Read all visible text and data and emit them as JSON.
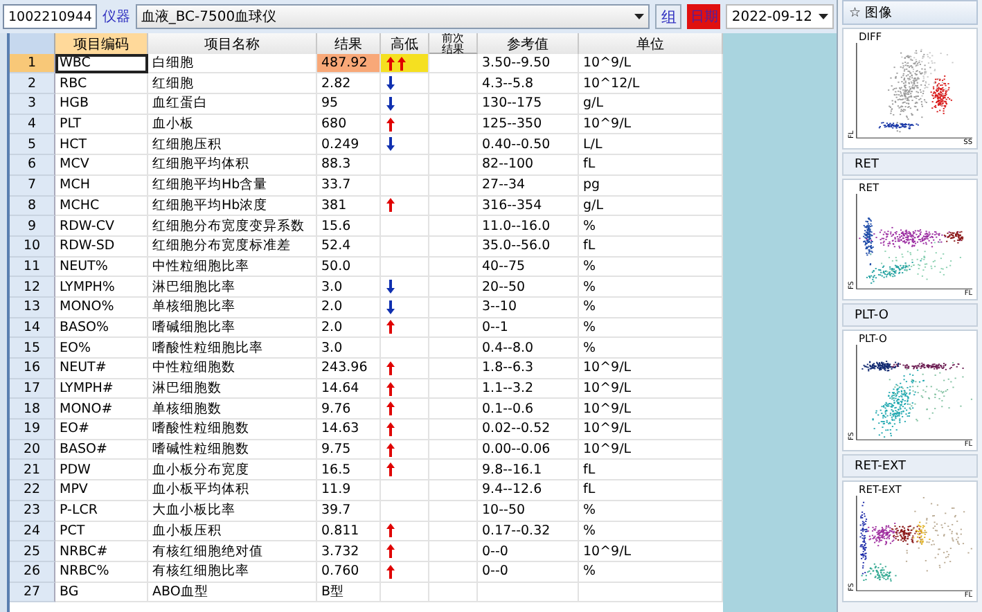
{
  "toolbar": {
    "sample_id": "1002210944",
    "instrument_label": "仪器",
    "instrument": "血液_BC-7500血球仪",
    "group_button": "组",
    "date_label": "日期",
    "date": "2022-09-12"
  },
  "table": {
    "columns": [
      "项目编码",
      "项目名称",
      "结果",
      "高低",
      "前次结果",
      "参考值",
      "单位"
    ],
    "rows": [
      {
        "no": "1",
        "code": "WBC",
        "name": "白细胞",
        "result": "487.92",
        "high": true,
        "low": false,
        "critical": true,
        "ref": "3.50--9.50",
        "unit": "10^9/L",
        "selected": true
      },
      {
        "no": "2",
        "code": "RBC",
        "name": "红细胞",
        "result": "2.82",
        "high": false,
        "low": true,
        "critical": false,
        "ref": "4.3--5.8",
        "unit": "10^12/L",
        "selected": false
      },
      {
        "no": "3",
        "code": "HGB",
        "name": "血红蛋白",
        "result": "95",
        "high": false,
        "low": true,
        "critical": false,
        "ref": "130--175",
        "unit": "g/L",
        "selected": false
      },
      {
        "no": "4",
        "code": "PLT",
        "name": "血小板",
        "result": "680",
        "high": true,
        "low": false,
        "critical": false,
        "ref": "125--350",
        "unit": "10^9/L",
        "selected": false
      },
      {
        "no": "5",
        "code": "HCT",
        "name": "红细胞压积",
        "result": "0.249",
        "high": false,
        "low": true,
        "critical": false,
        "ref": "0.40--0.50",
        "unit": "L/L",
        "selected": false
      },
      {
        "no": "6",
        "code": "MCV",
        "name": "红细胞平均体积",
        "result": "88.3",
        "high": false,
        "low": false,
        "critical": false,
        "ref": "82--100",
        "unit": "fL",
        "selected": false
      },
      {
        "no": "7",
        "code": "MCH",
        "name": "红细胞平均Hb含量",
        "result": "33.7",
        "high": false,
        "low": false,
        "critical": false,
        "ref": "27--34",
        "unit": "pg",
        "selected": false
      },
      {
        "no": "8",
        "code": "MCHC",
        "name": "红细胞平均Hb浓度",
        "result": "381",
        "high": true,
        "low": false,
        "critical": false,
        "ref": "316--354",
        "unit": "g/L",
        "selected": false
      },
      {
        "no": "9",
        "code": "RDW-CV",
        "name": "红细胞分布宽度变异系数",
        "result": "15.6",
        "high": false,
        "low": false,
        "critical": false,
        "ref": "11.0--16.0",
        "unit": "%",
        "selected": false
      },
      {
        "no": "10",
        "code": "RDW-SD",
        "name": "红细胞分布宽度标准差",
        "result": "52.4",
        "high": false,
        "low": false,
        "critical": false,
        "ref": "35.0--56.0",
        "unit": "fL",
        "selected": false
      },
      {
        "no": "11",
        "code": "NEUT%",
        "name": "中性粒细胞比率",
        "result": "50.0",
        "high": false,
        "low": false,
        "critical": false,
        "ref": "40--75",
        "unit": "%",
        "selected": false
      },
      {
        "no": "12",
        "code": "LYMPH%",
        "name": "淋巴细胞比率",
        "result": "3.0",
        "high": false,
        "low": true,
        "critical": false,
        "ref": "20--50",
        "unit": "%",
        "selected": false
      },
      {
        "no": "13",
        "code": "MONO%",
        "name": "单核细胞比率",
        "result": "2.0",
        "high": false,
        "low": true,
        "critical": false,
        "ref": "3--10",
        "unit": "%",
        "selected": false
      },
      {
        "no": "14",
        "code": "BASO%",
        "name": "嗜碱细胞比率",
        "result": "2.0",
        "high": true,
        "low": false,
        "critical": false,
        "ref": "0--1",
        "unit": "%",
        "selected": false
      },
      {
        "no": "15",
        "code": "EO%",
        "name": "嗜酸性粒细胞比率",
        "result": "3.0",
        "high": false,
        "low": false,
        "critical": false,
        "ref": "0.4--8.0",
        "unit": "%",
        "selected": false
      },
      {
        "no": "16",
        "code": "NEUT#",
        "name": "中性粒细胞数",
        "result": "243.96",
        "high": true,
        "low": false,
        "critical": false,
        "ref": "1.8--6.3",
        "unit": "10^9/L",
        "selected": false
      },
      {
        "no": "17",
        "code": "LYMPH#",
        "name": "淋巴细胞数",
        "result": "14.64",
        "high": true,
        "low": false,
        "critical": false,
        "ref": "1.1--3.2",
        "unit": "10^9/L",
        "selected": false
      },
      {
        "no": "18",
        "code": "MONO#",
        "name": "单核细胞数",
        "result": "9.76",
        "high": true,
        "low": false,
        "critical": false,
        "ref": "0.1--0.6",
        "unit": "10^9/L",
        "selected": false
      },
      {
        "no": "19",
        "code": "EO#",
        "name": "嗜酸性粒细胞数",
        "result": "14.63",
        "high": true,
        "low": false,
        "critical": false,
        "ref": "0.02--0.52",
        "unit": "10^9/L",
        "selected": false
      },
      {
        "no": "20",
        "code": "BASO#",
        "name": "嗜碱性粒细胞数",
        "result": "9.75",
        "high": true,
        "low": false,
        "critical": false,
        "ref": "0.00--0.06",
        "unit": "10^9/L",
        "selected": false
      },
      {
        "no": "21",
        "code": "PDW",
        "name": "血小板分布宽度",
        "result": "16.5",
        "high": true,
        "low": false,
        "critical": false,
        "ref": "9.8--16.1",
        "unit": "fL",
        "selected": false
      },
      {
        "no": "22",
        "code": "MPV",
        "name": "血小板平均体积",
        "result": "11.9",
        "high": false,
        "low": false,
        "critical": false,
        "ref": "9.4--12.6",
        "unit": "fL",
        "selected": false
      },
      {
        "no": "23",
        "code": "P-LCR",
        "name": "大血小板比率",
        "result": "39.7",
        "high": false,
        "low": false,
        "critical": false,
        "ref": "10--50",
        "unit": "%",
        "selected": false
      },
      {
        "no": "24",
        "code": "PCT",
        "name": "血小板压积",
        "result": "0.811",
        "high": true,
        "low": false,
        "critical": false,
        "ref": "0.17--0.32",
        "unit": "%",
        "selected": false
      },
      {
        "no": "25",
        "code": "NRBC#",
        "name": "有核红细胞绝对值",
        "result": "3.732",
        "high": true,
        "low": false,
        "critical": false,
        "ref": "0--0",
        "unit": "10^9/L",
        "selected": false
      },
      {
        "no": "26",
        "code": "NRBC%",
        "name": "有核红细胞比率",
        "result": "0.760",
        "high": true,
        "low": false,
        "critical": false,
        "ref": "0--0",
        "unit": "%",
        "selected": false
      },
      {
        "no": "27",
        "code": "BG",
        "name": "ABO血型",
        "result": "B型",
        "high": false,
        "low": false,
        "critical": false,
        "selected": false
      }
    ]
  },
  "images": {
    "title": "☆ 图像",
    "plots": [
      {
        "kind": "diff",
        "label": "DIFF",
        "y_axis": "FL",
        "x_axis": "SS"
      },
      {
        "kind": "ret",
        "header": "RET",
        "label": "RET",
        "y_axis": "FS",
        "x_axis": "FL"
      },
      {
        "kind": "plt",
        "header": "PLT-O",
        "label": "PLT-O",
        "y_axis": "FS",
        "x_axis": "FL"
      },
      {
        "kind": "retext",
        "header": "RET-EXT",
        "label": "RET-EXT",
        "y_axis": "FS",
        "x_axis": "FL"
      }
    ]
  }
}
